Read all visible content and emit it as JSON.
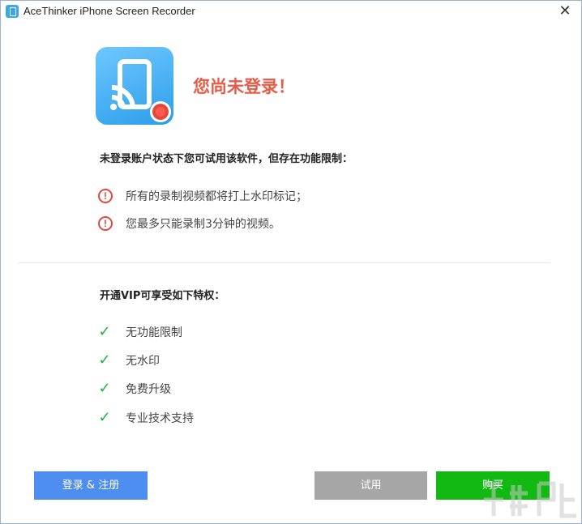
{
  "window": {
    "title": "AceThinker iPhone Screen Recorder",
    "close_glyph": "✕"
  },
  "hero": {
    "icon": "phone-cast-record-icon",
    "headline": "您尚未登录！"
  },
  "limits": {
    "title": "未登录账户状态下您可试用该软件，但存在功能限制：",
    "icon_glyph": "!",
    "items": [
      "所有的录制视频都将打上水印标记；",
      "您最多只能录制3分钟的视频。"
    ]
  },
  "vip": {
    "title": "开通VIP可享受如下特权：",
    "check_glyph": "✓",
    "items": [
      "无功能限制",
      "无水印",
      "免费升级",
      "专业技术支持"
    ]
  },
  "buttons": {
    "login": "登录 & 注册",
    "trial": "试用",
    "buy": "购买"
  },
  "colors": {
    "headline": "#e85b47",
    "warning": "#e0493b",
    "check": "#19b13d",
    "login_button": "#4e8ef0",
    "trial_button": "#a6a6a6",
    "buy_button": "#13b913"
  }
}
